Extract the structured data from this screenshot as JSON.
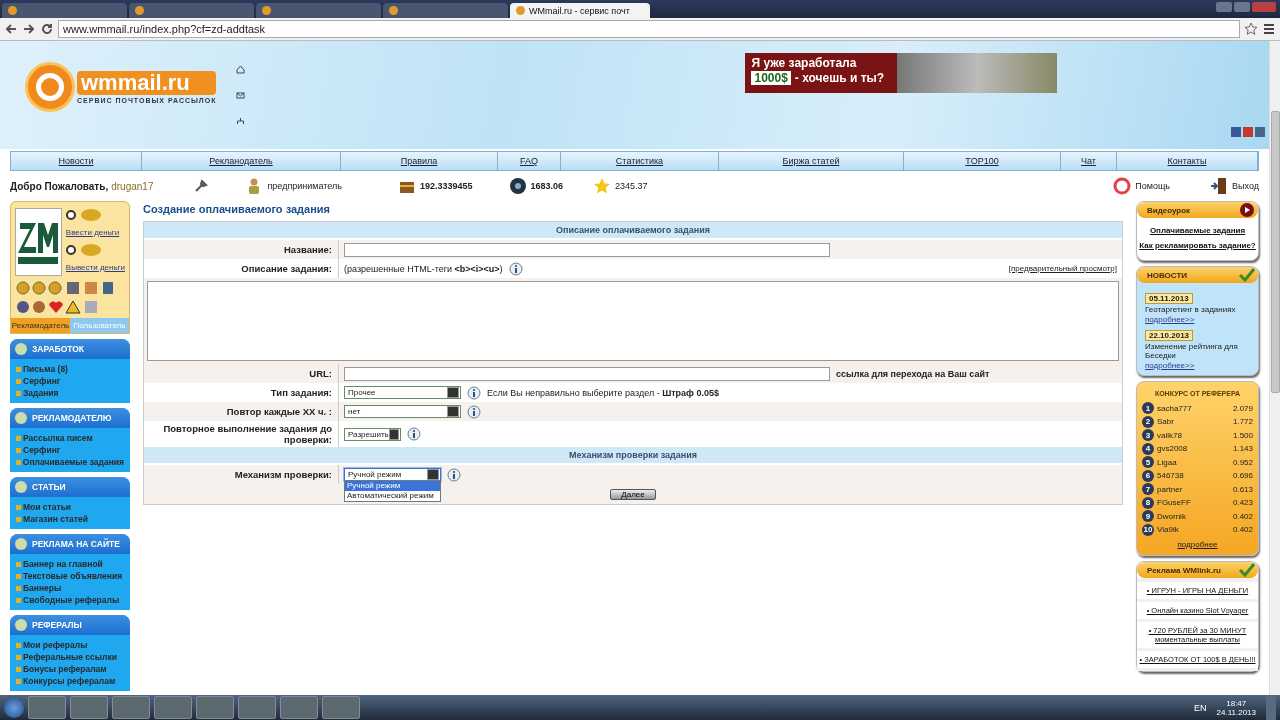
{
  "browser": {
    "tabs": [
      {
        "selected": false
      },
      {
        "selected": false
      },
      {
        "selected": false
      },
      {
        "selected": false
      },
      {
        "title": "WMmail.ru - сервис почт",
        "selected": true
      }
    ],
    "address": "www.wmmail.ru/index.php?cf=zd-addtask"
  },
  "header": {
    "logo": {
      "name": "wmmail.ru",
      "tagline": "СЕРВИС ПОЧТОВЫХ РАССЫЛОК"
    },
    "banner": {
      "line1": "Я уже заработала",
      "amount": "1000$",
      "line2": "- хочешь и ты?"
    }
  },
  "nav": [
    "Новости",
    "Рекланодатель",
    "Правила",
    "FAQ",
    "Статистика",
    "Биржа статей",
    "TOP100",
    "Чат",
    "Контакты"
  ],
  "user_bar": {
    "greeting": "Добро Пожаловать,",
    "username": "drugan17",
    "status": "предприниматель",
    "balance": "192.3339455",
    "points": "1683.06",
    "rating": "2345.37",
    "help": "Помощь",
    "logout": "Выход"
  },
  "wallet": {
    "deposit": "Ввести деньги",
    "withdraw": "Вывести деньги",
    "tabs": [
      {
        "label": "Рекламодатель",
        "selected": true
      },
      {
        "label": "Пользователь",
        "selected": false
      }
    ]
  },
  "menus": [
    {
      "title": "ЗАРАБОТОК",
      "items": [
        "Письма (8)",
        "Серфинг",
        "Задания"
      ]
    },
    {
      "title": "РЕКЛАМОДАТЕЛЮ",
      "items": [
        "Рассылка писем",
        "Серфинг",
        "Оплачиваемые задания"
      ]
    },
    {
      "title": "СТАТЬИ",
      "items": [
        "Мои статьи",
        "Магазин статей"
      ]
    },
    {
      "title": "РЕКЛАМА НА САЙТЕ",
      "items": [
        "Баннер на главной",
        "Текстовые объявления",
        "Баннеры",
        "Свободные рефералы"
      ]
    },
    {
      "title": "РЕФЕРАЛЫ",
      "items": [
        "Мои рефералы",
        "Реферальные ссылки",
        "Бонусы рефералам",
        "Конкурсы рефералам"
      ]
    }
  ],
  "form": {
    "title": "Создание оплачиваемого задания",
    "sections": [
      {
        "heading": "Описание оплачиваемого задания",
        "rows": [
          {
            "kind": "input",
            "label": "Название:"
          },
          {
            "kind": "description",
            "label": "Описание задания:",
            "hint": "(разрешенные HTML-теги **<b><i><u>**)",
            "preview_link": "[предварительный просмотр]"
          },
          {
            "kind": "textarea"
          },
          {
            "kind": "input",
            "label": "URL:",
            "note": "ссылка для перехода на Ваш сайт"
          },
          {
            "kind": "select",
            "label": "Тип задания:",
            "value": "Прочее",
            "note": "Если Вы неправильно выберите раздел - **Штраф 0.05$**"
          },
          {
            "kind": "select",
            "label": "Повтор каждые XX ч. :",
            "value": "нет"
          },
          {
            "kind": "select",
            "label": "Повторное выполнение задания до проверки:",
            "value": "Разрешить"
          }
        ]
      },
      {
        "heading": "Механизм проверки задания",
        "rows": [
          {
            "kind": "select",
            "label": "Механизм проверки:",
            "value": "Ручной режим",
            "open": true,
            "options": [
              {
                "label": "Ручной режим",
                "selected": true
              },
              {
                "label": "Автоматический режим",
                "selected": false
              }
            ]
          }
        ]
      }
    ],
    "submit": "Далее"
  },
  "video": {
    "title": "Видеоурок",
    "links": [
      "Оплачиваемые задания",
      "Как рекламировать задание?"
    ]
  },
  "news": {
    "title": "НОВОСТИ",
    "items": [
      {
        "date": "05.11.2013",
        "text": "Геотаргетинг в заданиях",
        "link": "подробнее>>"
      },
      {
        "date": "22.10.2013",
        "text": "Изменение рейтинга для Беседки",
        "link": "подробнее>>"
      }
    ]
  },
  "contest": {
    "title": "КОНКУРС ОТ РЕФЕРЕРА",
    "rows": [
      {
        "rank": "1",
        "name": "sacha777",
        "score": "2.079"
      },
      {
        "rank": "2",
        "name": "Sabr",
        "score": "1.772"
      },
      {
        "rank": "3",
        "name": "valik78",
        "score": "1.500"
      },
      {
        "rank": "4",
        "name": "gvs2008",
        "score": "1.143"
      },
      {
        "rank": "5",
        "name": "Ligaa",
        "score": "0.952"
      },
      {
        "rank": "6",
        "name": "546738",
        "score": "0.696"
      },
      {
        "rank": "7",
        "name": "partner",
        "score": "0.613"
      },
      {
        "rank": "8",
        "name": "FGuseFF",
        "score": "0.423"
      },
      {
        "rank": "9",
        "name": "Dwornik",
        "score": "0.402"
      },
      {
        "rank": "10",
        "name": "Vla9ik",
        "score": "0.402"
      }
    ],
    "more": "подробнее"
  },
  "ads": {
    "title": "Реклама WMlink.ru",
    "links": [
      "• ИГРУН - ИГРЫ НА ДЕНЬГИ",
      "• Онлайн казино Slot Voyager",
      "• 720 РУБЛЕЙ за 30 МИНУТ моментальные выплаты",
      "• ЗАРАБОТОК ОТ 100$ В ДЕНЬ!!!"
    ]
  },
  "taskbar": {
    "language": "EN",
    "time": "18:47",
    "date": "24.11.2013"
  }
}
